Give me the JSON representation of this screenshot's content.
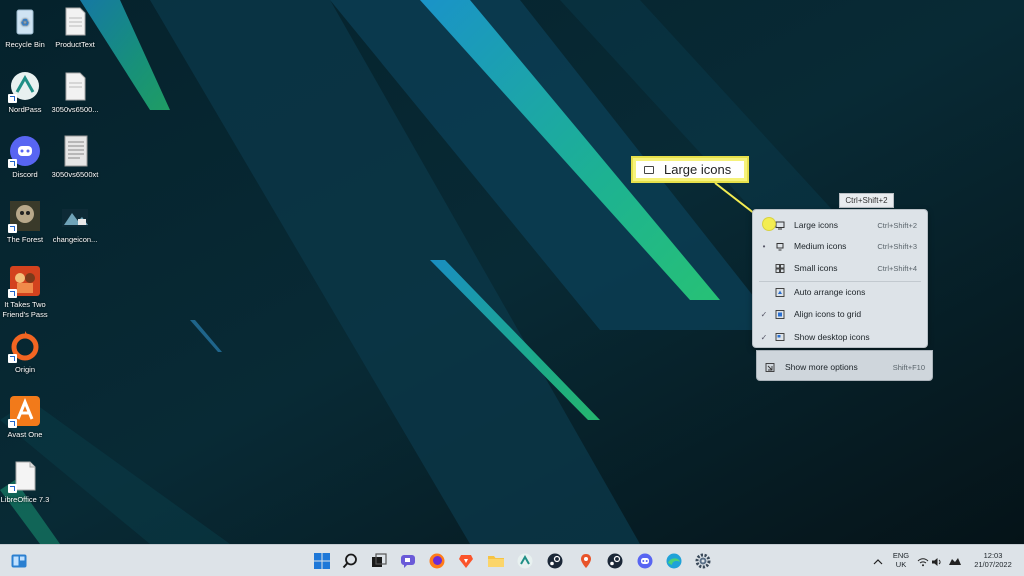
{
  "desktop": {
    "icons": [
      {
        "label": "Recycle Bin",
        "icon": "recycle-bin-icon"
      },
      {
        "label": "ProductText",
        "icon": "document-icon"
      },
      {
        "label": "NordPass",
        "icon": "nordpass-icon"
      },
      {
        "label": "3050vs6500...",
        "icon": "document-icon"
      },
      {
        "label": "Discord",
        "icon": "discord-icon"
      },
      {
        "label": "3050vs6500xt",
        "icon": "text-document-icon"
      },
      {
        "label": "The Forest",
        "icon": "the-forest-icon"
      },
      {
        "label": "changeicon...",
        "icon": "image-icon"
      },
      {
        "label": "It Takes Two Friend's Pass",
        "icon": "it-takes-two-icon"
      },
      {
        "label": "Origin",
        "icon": "origin-icon"
      },
      {
        "label": "Avast One",
        "icon": "avast-icon"
      },
      {
        "label": "LibreOffice 7.3",
        "icon": "libreoffice-icon"
      }
    ]
  },
  "callout": {
    "label": "Large icons"
  },
  "tooltip": {
    "text": "Ctrl+Shift+2"
  },
  "submenu": {
    "items": [
      {
        "label": "Large icons",
        "shortcut": "Ctrl+Shift+2",
        "mark": ""
      },
      {
        "label": "Medium icons",
        "shortcut": "Ctrl+Shift+3",
        "mark": "•"
      },
      {
        "label": "Small icons",
        "shortcut": "Ctrl+Shift+4",
        "mark": ""
      },
      {
        "label": "Auto arrange icons",
        "shortcut": "",
        "mark": ""
      },
      {
        "label": "Align icons to grid",
        "shortcut": "",
        "mark": "✓"
      },
      {
        "label": "Show desktop icons",
        "shortcut": "",
        "mark": "✓"
      }
    ]
  },
  "mainmenu": {
    "more_options": {
      "label": "Show more options",
      "shortcut": "Shift+F10"
    }
  },
  "taskbar": {
    "items": [
      "widgets-icon",
      "start-icon",
      "search-icon",
      "task-view-icon",
      "chat-icon",
      "firefox-icon",
      "brave-icon",
      "file-explorer-icon",
      "nordpass-icon",
      "steam-icon",
      "maps-icon",
      "steam-icon",
      "discord-icon",
      "edge-icon",
      "settings-icon"
    ],
    "tray": {
      "lang_top": "ENG",
      "lang_bottom": "UK",
      "time": "12:03",
      "date": "21/07/2022"
    }
  },
  "colors": {
    "callout": "#f6f27a",
    "menu_bg": "#dde3e8",
    "taskbar_bg": "#dde3e8"
  }
}
